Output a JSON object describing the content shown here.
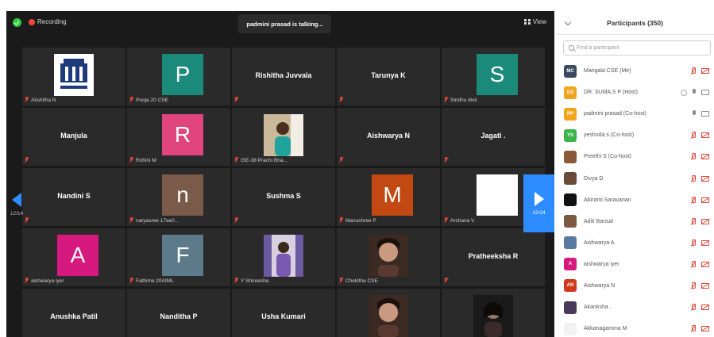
{
  "meeting": {
    "recording_label": "Recording",
    "talking_label": "padmini prasad is talking...",
    "view_label": "View",
    "page_indicator_left": "12/14",
    "page_indicator_right": "12/14"
  },
  "tiles": [
    {
      "kind": "photo",
      "photo": "logo",
      "label": "Akshitha N"
    },
    {
      "kind": "avatar",
      "letter": "P",
      "color": "#1b8a7a",
      "label": "Pooja 20 CSE"
    },
    {
      "kind": "name",
      "name": "Rishitha Juvvala",
      "label": ""
    },
    {
      "kind": "name",
      "name": "Tarunya K",
      "label": ""
    },
    {
      "kind": "avatar",
      "letter": "S",
      "color": "#1b8a7a",
      "label": "Sindhu divil"
    },
    {
      "kind": "name",
      "name": "Manjula",
      "label": ""
    },
    {
      "kind": "avatar",
      "letter": "R",
      "color": "#e0457b",
      "label": "Rohini M"
    },
    {
      "kind": "photo",
      "photo": "person-teal",
      "label": "ISE-38 Prachi Bha..."
    },
    {
      "kind": "name",
      "name": "Aishwarya N",
      "label": ""
    },
    {
      "kind": "name",
      "name": "Jagati .",
      "label": ""
    },
    {
      "kind": "name",
      "name": "Nandini S",
      "label": ""
    },
    {
      "kind": "avatar",
      "letter": "n",
      "color": "#7a5a48",
      "label": "naryasree 17ee0..."
    },
    {
      "kind": "name",
      "name": "Sushma S",
      "label": ""
    },
    {
      "kind": "avatar",
      "letter": "M",
      "color": "#c24a12",
      "label": "Manushree P"
    },
    {
      "kind": "avatar",
      "letter": "",
      "color": "#ffffff",
      "label": "Archana V"
    },
    {
      "kind": "avatar",
      "letter": "A",
      "color": "#d6197e",
      "label": "aishwarya iyer"
    },
    {
      "kind": "avatar",
      "letter": "F",
      "color": "#5c7a8a",
      "label": "Fathima 20AIML"
    },
    {
      "kind": "photo",
      "photo": "person-purple",
      "label": "Y Shireesha"
    },
    {
      "kind": "photo",
      "photo": "person-selfie",
      "label": "Chekitha CSE"
    },
    {
      "kind": "name",
      "name": "Pratheeksha R",
      "label": ""
    },
    {
      "kind": "name",
      "name": "Anushka Patil",
      "label": ""
    },
    {
      "kind": "name",
      "name": "Nanditha P",
      "label": ""
    },
    {
      "kind": "name",
      "name": "Usha Kumari",
      "label": ""
    },
    {
      "kind": "photo",
      "photo": "person-selfie",
      "label": ""
    },
    {
      "kind": "photo",
      "photo": "person-dark",
      "label": ""
    }
  ],
  "panel": {
    "title": "Participants (350)",
    "search_placeholder": "Find a participant"
  },
  "participants": [
    {
      "initials": "MC",
      "color": "#3b4a63",
      "name": "Mangala CSE (Me)",
      "status": "muted"
    },
    {
      "initials": "DS",
      "color": "#f2a41c",
      "name": "DR. SUMA S P (Host)",
      "status": "host"
    },
    {
      "initials": "PP",
      "color": "#f2a41c",
      "name": "padmini prasad (Co-host)",
      "status": "active"
    },
    {
      "initials": "YS",
      "color": "#3bb54a",
      "name": "yeshoda s (Co-host)",
      "status": "muted"
    },
    {
      "initials": "",
      "color": "#8a5a3a",
      "name": "Preethi S (Co-host)",
      "status": "muted"
    },
    {
      "initials": "",
      "color": "#6a4a3a",
      "name": "Divya D",
      "status": "muted"
    },
    {
      "initials": "",
      "color": "#111111",
      "name": "Abirami Saravanan",
      "status": "muted"
    },
    {
      "initials": "",
      "color": "#7a5a40",
      "name": "Aditi Bansal",
      "status": "muted"
    },
    {
      "initials": "",
      "color": "#5a7aa0",
      "name": "Aishwarya A",
      "status": "muted"
    },
    {
      "initials": "A",
      "color": "#d6197e",
      "name": "aishwarya iyer",
      "status": "muted"
    },
    {
      "initials": "AN",
      "color": "#d2381c",
      "name": "Aishwarya N",
      "status": "muted"
    },
    {
      "initials": "",
      "color": "#4a3a5a",
      "name": "Akanksha .",
      "status": "muted"
    },
    {
      "initials": "",
      "color": "#f2f2f2",
      "name": "Akkanagamma M",
      "status": "muted"
    }
  ]
}
